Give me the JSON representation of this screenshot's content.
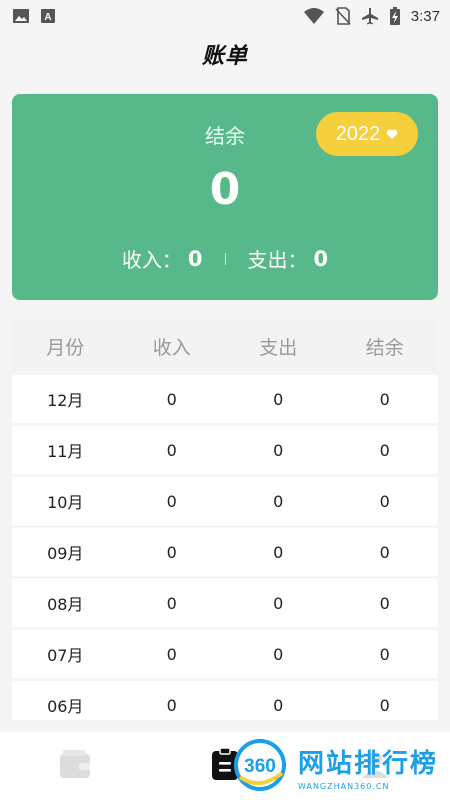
{
  "status_bar": {
    "time": "3:37",
    "left_icons": [
      "image-icon",
      "font-icon"
    ],
    "right_icons": [
      "wifi-icon",
      "no-sim-icon",
      "airplane-icon",
      "battery-charging-icon"
    ]
  },
  "header": {
    "title": "账单"
  },
  "summary": {
    "balance_label": "结余",
    "balance_value": "0",
    "year": "2022",
    "income_label": "收入：",
    "income_value": "0",
    "expense_label": "支出：",
    "expense_value": "0",
    "accent_color": "#57b98a",
    "year_button_color": "#f5cf3c"
  },
  "table": {
    "headers": [
      "月份",
      "收入",
      "支出",
      "结余"
    ],
    "rows": [
      [
        "12月",
        "0",
        "0",
        "0"
      ],
      [
        "11月",
        "0",
        "0",
        "0"
      ],
      [
        "10月",
        "0",
        "0",
        "0"
      ],
      [
        "09月",
        "0",
        "0",
        "0"
      ],
      [
        "08月",
        "0",
        "0",
        "0"
      ],
      [
        "07月",
        "0",
        "0",
        "0"
      ],
      [
        "06月",
        "0",
        "0",
        "0"
      ]
    ]
  },
  "bottom_nav": {
    "items": [
      {
        "icon": "wallet-icon",
        "active": false
      },
      {
        "icon": "clipboard-icon",
        "active": true
      },
      {
        "icon": "user-icon",
        "active": false
      }
    ]
  },
  "watermark": {
    "main": "网站排行榜",
    "sub": "WANGZHAN360.CN",
    "logo": "360"
  }
}
